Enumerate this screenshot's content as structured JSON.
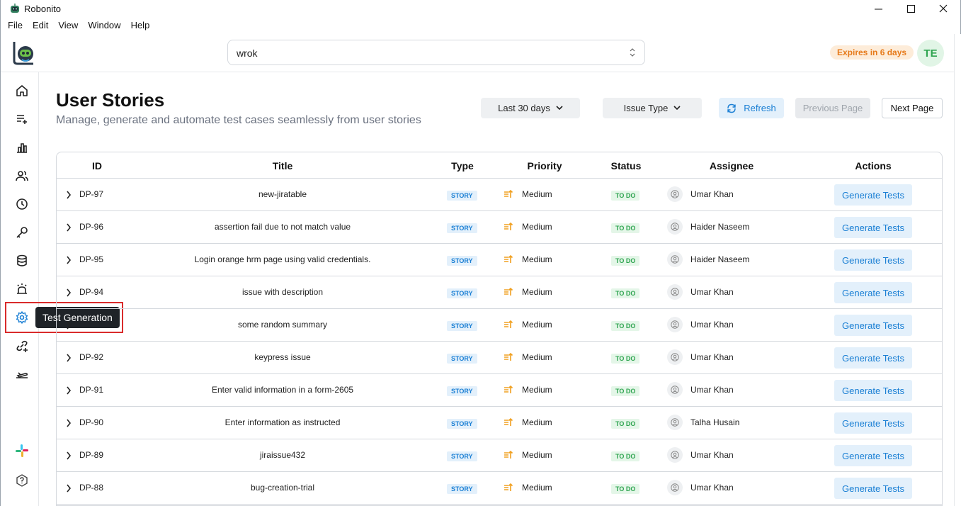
{
  "window": {
    "title": "Robonito"
  },
  "menu": [
    "File",
    "Edit",
    "View",
    "Window",
    "Help"
  ],
  "header": {
    "project_select_value": "wrok",
    "expires_label": "Expires in 6 days",
    "user_initials": "TE"
  },
  "sidebar": {
    "items": [
      {
        "name": "home-icon"
      },
      {
        "name": "add-list-icon"
      },
      {
        "name": "chart-icon"
      },
      {
        "name": "users-icon"
      },
      {
        "name": "clock-icon"
      },
      {
        "name": "key-icon"
      },
      {
        "name": "database-icon"
      },
      {
        "name": "alarm-icon"
      },
      {
        "name": "gear-icon"
      },
      {
        "name": "link-add-icon"
      },
      {
        "name": "plane-icon"
      }
    ],
    "tooltip": "Test Generation",
    "bottom": [
      {
        "name": "slack-icon"
      },
      {
        "name": "help-icon"
      }
    ]
  },
  "page": {
    "title": "User Stories",
    "subtitle": "Manage, generate and automate test cases seamlessly from user stories"
  },
  "toolbar": {
    "date_filter": "Last 30 days",
    "issue_type": "Issue Type",
    "refresh": "Refresh",
    "previous_page": "Previous Page",
    "next_page": "Next Page"
  },
  "table": {
    "columns": [
      "ID",
      "Title",
      "Type",
      "Priority",
      "Status",
      "Assignee",
      "Actions"
    ],
    "rows": [
      {
        "id": "DP-97",
        "title": "new-jiratable",
        "type": "STORY",
        "priority": "Medium",
        "status": "TO DO",
        "assignee": "Umar Khan",
        "action": "Generate Tests"
      },
      {
        "id": "DP-96",
        "title": "assertion fail due to not match value",
        "type": "STORY",
        "priority": "Medium",
        "status": "TO DO",
        "assignee": "Haider Naseem",
        "action": "Generate Tests"
      },
      {
        "id": "DP-95",
        "title": "Login orange hrm page using valid credentials.",
        "type": "STORY",
        "priority": "Medium",
        "status": "TO DO",
        "assignee": "Haider Naseem",
        "action": "Generate Tests"
      },
      {
        "id": "DP-94",
        "title": "issue with description",
        "type": "STORY",
        "priority": "Medium",
        "status": "TO DO",
        "assignee": "Umar Khan",
        "action": "Generate Tests"
      },
      {
        "id": "",
        "title": "some random summary",
        "type": "STORY",
        "priority": "Medium",
        "status": "TO DO",
        "assignee": "Umar Khan",
        "action": "Generate Tests"
      },
      {
        "id": "DP-92",
        "title": "keypress issue",
        "type": "STORY",
        "priority": "Medium",
        "status": "TO DO",
        "assignee": "Umar Khan",
        "action": "Generate Tests"
      },
      {
        "id": "DP-91",
        "title": "Enter valid information in a form-2605",
        "type": "STORY",
        "priority": "Medium",
        "status": "TO DO",
        "assignee": "Umar Khan",
        "action": "Generate Tests"
      },
      {
        "id": "DP-90",
        "title": "Enter information as instructed",
        "type": "STORY",
        "priority": "Medium",
        "status": "TO DO",
        "assignee": "Talha Husain",
        "action": "Generate Tests"
      },
      {
        "id": "DP-89",
        "title": "jiraissue432",
        "type": "STORY",
        "priority": "Medium",
        "status": "TO DO",
        "assignee": "Umar Khan",
        "action": "Generate Tests"
      },
      {
        "id": "DP-88",
        "title": "bug-creation-trial",
        "type": "STORY",
        "priority": "Medium",
        "status": "TO DO",
        "assignee": "Umar Khan",
        "action": "Generate Tests"
      }
    ]
  },
  "colors": {
    "accent": "#1a7fd4",
    "success": "#2ea44f",
    "warning": "#e67a1a",
    "highlight": "#d92b2b"
  }
}
